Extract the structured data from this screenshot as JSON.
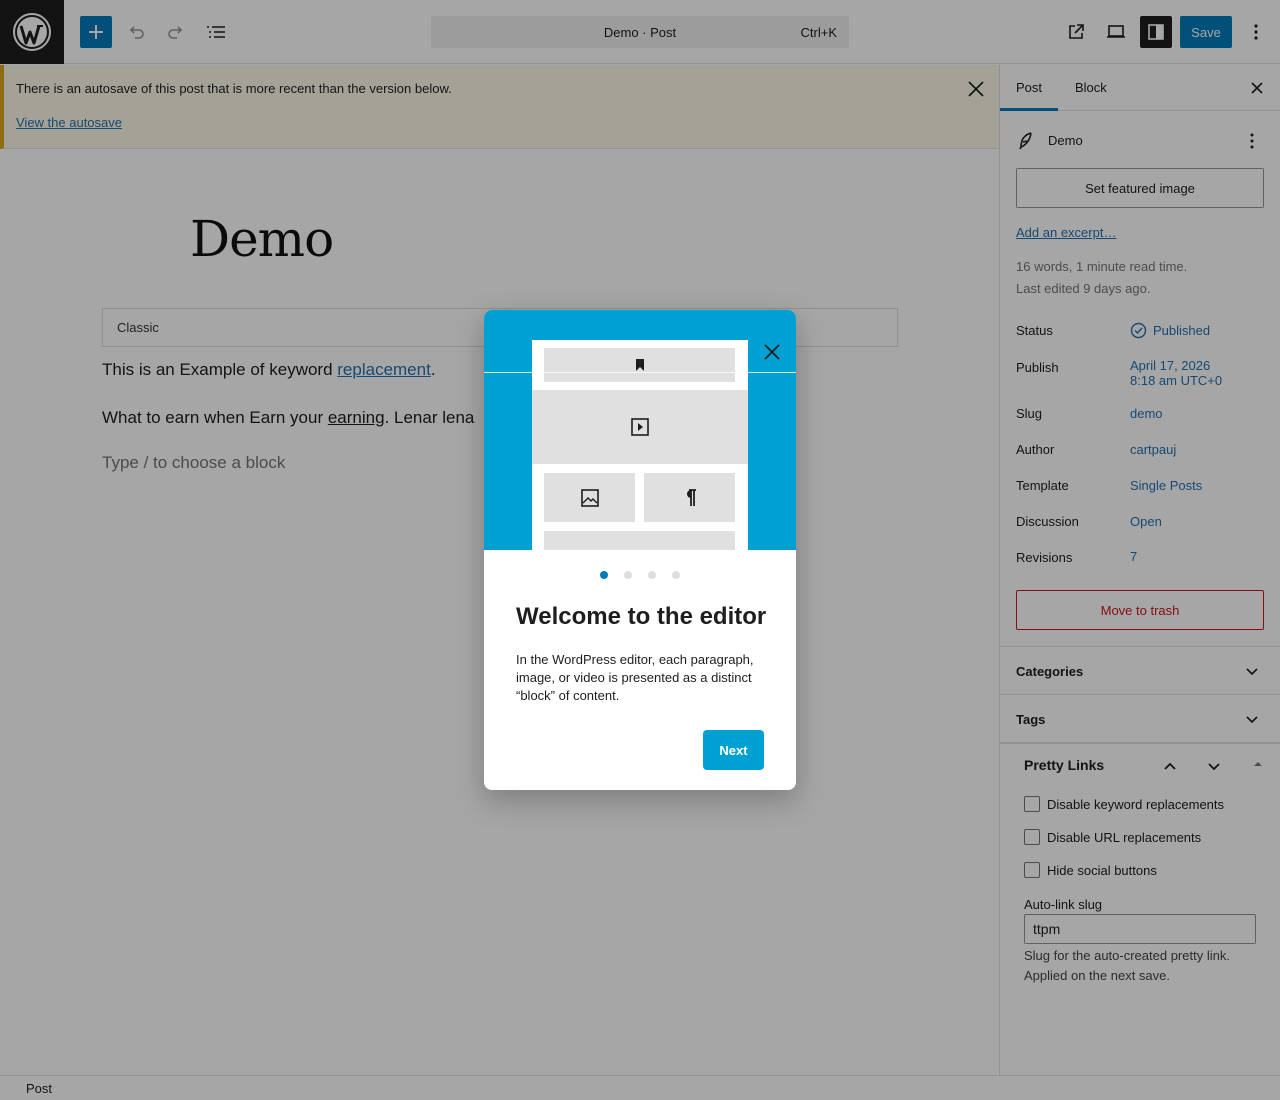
{
  "topbar": {
    "logo": "wordpress-logo",
    "document_title": "Demo · Post",
    "shortcut": "Ctrl+K",
    "save_label": "Save"
  },
  "notice": {
    "message": "There is an autosave of this post that is more recent than the version below.",
    "link_text": "View the autosave"
  },
  "editor": {
    "title": "Demo",
    "classic_label": "Classic",
    "para1_prefix": "This is an Example of keyword ",
    "para1_link": "replacement",
    "para1_suffix": ".",
    "para2_prefix": "What to earn when Earn your ",
    "para2_underlined": "earning",
    "para2_suffix": ". Lenar lena",
    "placeholder": "Type / to choose a block"
  },
  "sidebar": {
    "tabs": [
      "Post",
      "Block"
    ],
    "post_name": "Demo",
    "featured_image_label": "Set featured image",
    "excerpt_link": "Add an excerpt…",
    "word_count": "16 words, 1 minute read time.",
    "last_edited": "Last edited 9 days ago.",
    "rows": {
      "status": {
        "label": "Status",
        "value": "Published"
      },
      "publish": {
        "label": "Publish",
        "value_line1": "April 17, 2026",
        "value_line2": "8:18 am UTC+0"
      },
      "slug": {
        "label": "Slug",
        "value": "demo"
      },
      "author": {
        "label": "Author",
        "value": "cartpauj"
      },
      "template": {
        "label": "Template",
        "value": "Single Posts"
      },
      "discussion": {
        "label": "Discussion",
        "value": "Open"
      },
      "revisions": {
        "label": "Revisions",
        "value": "7"
      }
    },
    "trash_label": "Move to trash",
    "categories_label": "Categories",
    "tags_label": "Tags",
    "pretty_links": {
      "title": "Pretty Links",
      "checkboxes": [
        "Disable keyword replacements",
        "Disable URL replacements",
        "Hide social buttons"
      ],
      "slug_label": "Auto-link slug",
      "slug_value": "ttpm",
      "slug_help": "Slug for the auto-created pretty link. Applied on the next save."
    }
  },
  "footer": {
    "breadcrumb": "Post"
  },
  "modal": {
    "heading": "Welcome to the editor",
    "body": "In the WordPress editor, each paragraph, image, or video is presented as a distinct “block” of content.",
    "next_label": "Next",
    "page_count": 4,
    "active_page": 1
  },
  "colors": {
    "accent": "#007cba",
    "hero": "#00a0d2",
    "danger": "#cc1818",
    "notice_border": "#dba617"
  }
}
